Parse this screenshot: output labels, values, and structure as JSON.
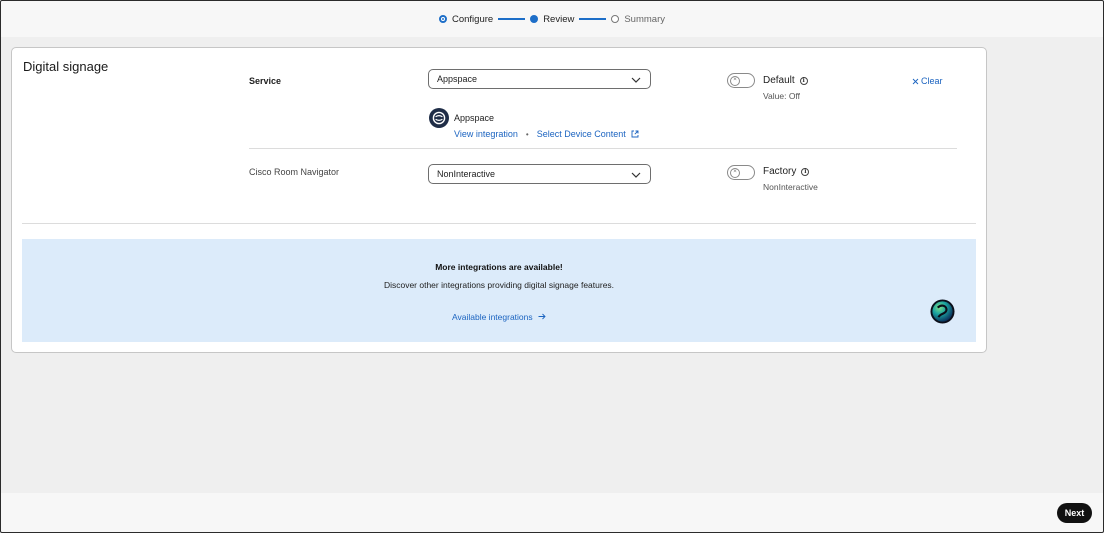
{
  "stepper": {
    "steps": [
      {
        "label": "Configure",
        "state": "done"
      },
      {
        "label": "Review",
        "state": "current"
      },
      {
        "label": "Summary",
        "state": "pending"
      }
    ]
  },
  "card": {
    "title": "Digital signage",
    "service": {
      "label": "Service",
      "selected": "Appspace",
      "provider_name": "Appspace",
      "view_integration": "View integration",
      "separator": "•",
      "select_device_content": "Select Device Content",
      "toggle_title": "Default",
      "toggle_value": "Value: Off",
      "toggle_state": "off",
      "clear_label": "Clear"
    },
    "navigator": {
      "label": "Cisco Room Navigator",
      "selected": "NonInteractive",
      "toggle_title": "Factory",
      "toggle_value": "NonInteractive",
      "toggle_state": "off"
    },
    "banner": {
      "title": "More integrations are available!",
      "description": "Discover other integrations providing digital signage features.",
      "link": "Available integrations"
    }
  },
  "footer": {
    "next_label": "Next"
  },
  "colors": {
    "accent": "#1d6ec8",
    "link": "#1c64c0",
    "banner_bg": "#dcebfa",
    "page_bg": "#efefef",
    "button_bg": "#111111"
  },
  "icons": [
    "chevron-down-icon",
    "info-icon",
    "external-link-icon",
    "close-icon",
    "arrow-right-icon",
    "appspace-logo-icon",
    "webex-orb-icon"
  ]
}
